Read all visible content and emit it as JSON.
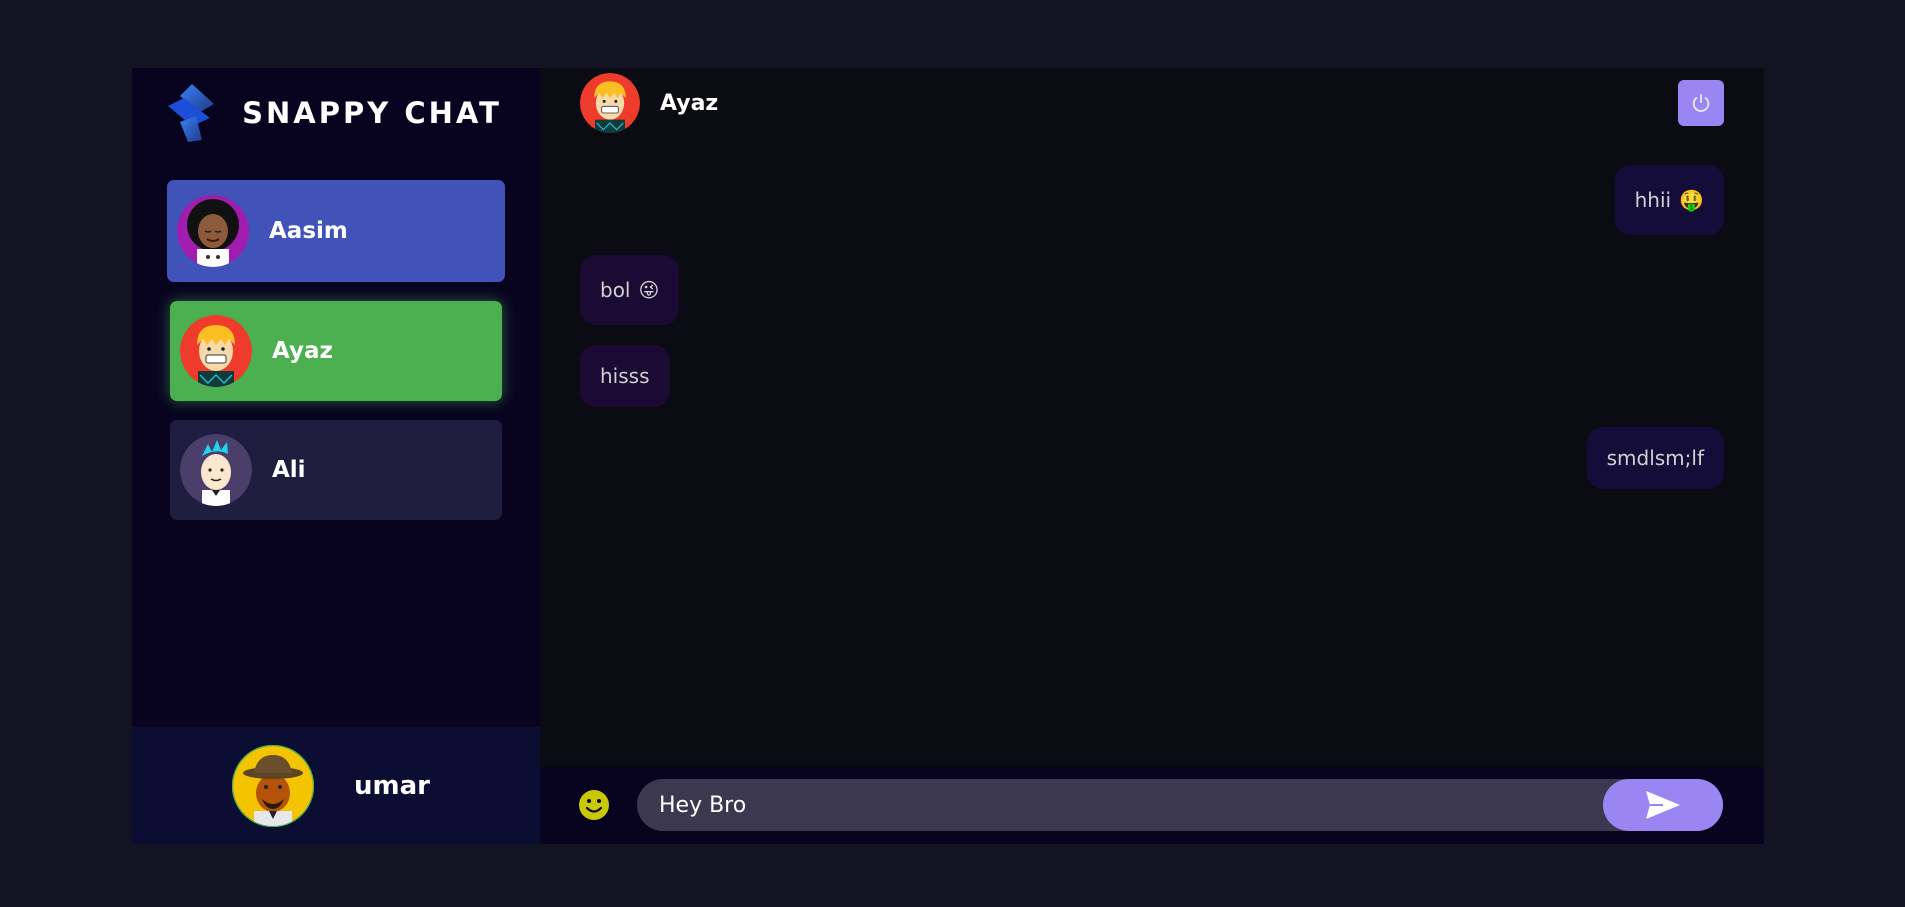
{
  "brand": {
    "name": "SNAPPY CHAT",
    "logo_icon": "snappy-logo-icon"
  },
  "contacts": [
    {
      "name": "Aasim",
      "avatar": "avatar-aasim-icon",
      "state": "selected",
      "color": "#4153b8"
    },
    {
      "name": "Ayaz",
      "avatar": "avatar-ayaz-icon",
      "state": "hover",
      "color": "#4caf50"
    },
    {
      "name": "Ali",
      "avatar": "avatar-ali-icon",
      "state": "default",
      "color": "#1f1d3f"
    }
  ],
  "current_user": {
    "name": "umar",
    "avatar": "avatar-umar-icon"
  },
  "chat": {
    "header": {
      "user_name": "Ayaz",
      "avatar": "avatar-ayaz-icon",
      "logout_icon": "power-icon"
    },
    "messages": [
      {
        "direction": "sent",
        "text": "hhii",
        "emoji": "🤑"
      },
      {
        "direction": "received",
        "text": "bol",
        "emoji": "😜"
      },
      {
        "direction": "received",
        "text": "hisss",
        "emoji": ""
      },
      {
        "direction": "sent",
        "text": "smdlsm;lf",
        "emoji": ""
      }
    ],
    "input": {
      "value": "Hey Bro",
      "emoji_icon": "smiley-icon",
      "send_icon": "send-icon"
    }
  },
  "colors": {
    "accent": "#9a86f3",
    "background": "#131324",
    "sidebar": "#080420",
    "current_user_bar": "#0c0d32"
  }
}
